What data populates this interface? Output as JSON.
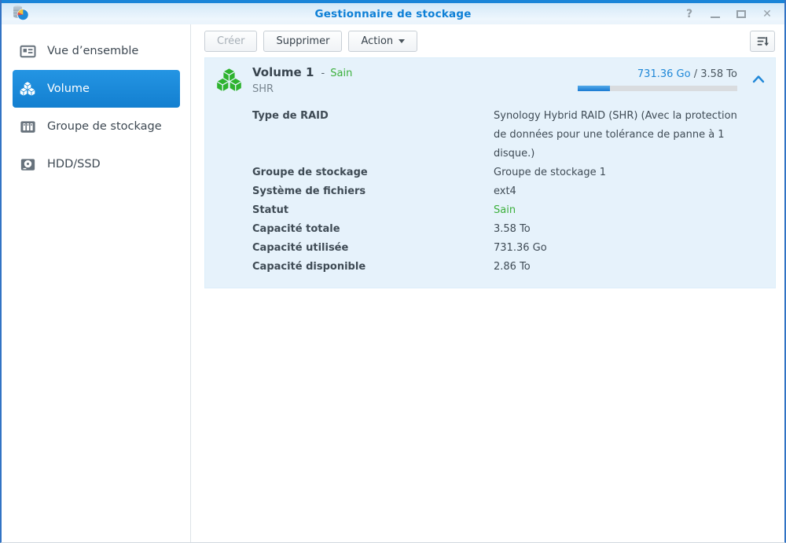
{
  "titlebar": {
    "title": "Gestionnaire de stockage",
    "help_glyph": "?",
    "close_glyph": "✕"
  },
  "sidebar": {
    "items": [
      {
        "label": "Vue d’ensemble",
        "icon": "overview-icon",
        "selected": false
      },
      {
        "label": "Volume",
        "icon": "volume-cubes-icon",
        "selected": true
      },
      {
        "label": "Groupe de stockage",
        "icon": "storage-pool-icon",
        "selected": false
      },
      {
        "label": "HDD/SSD",
        "icon": "hdd-ssd-icon",
        "selected": false
      }
    ]
  },
  "toolbar": {
    "create_label": "Créer",
    "delete_label": "Supprimer",
    "action_label": "Action"
  },
  "volume": {
    "name": "Volume 1",
    "separator": "-",
    "status": "Sain",
    "type": "SHR",
    "usage": {
      "used": "731.36 Go",
      "separator": "/",
      "total": "3.58 To",
      "percent": 20.4
    },
    "details": [
      {
        "label": "Type de RAID",
        "value": "Synology Hybrid RAID (SHR) (Avec la protection de données pour une tolérance de panne à 1 disque.)"
      },
      {
        "label": "Groupe de stockage",
        "value": "Groupe de stockage 1"
      },
      {
        "label": "Système de fichiers",
        "value": "ext4"
      },
      {
        "label": "Statut",
        "value": "Sain"
      },
      {
        "label": "Capacité totale",
        "value": "3.58 To"
      },
      {
        "label": "Capacité utilisée",
        "value": "731.36 Go"
      },
      {
        "label": "Capacité disponible",
        "value": "2.86 To"
      }
    ]
  },
  "colors": {
    "accent_blue": "#1588d8",
    "healthy_green": "#3cb03c",
    "link_blue": "#1e87d7",
    "title_blue": "#0d7fd6"
  }
}
